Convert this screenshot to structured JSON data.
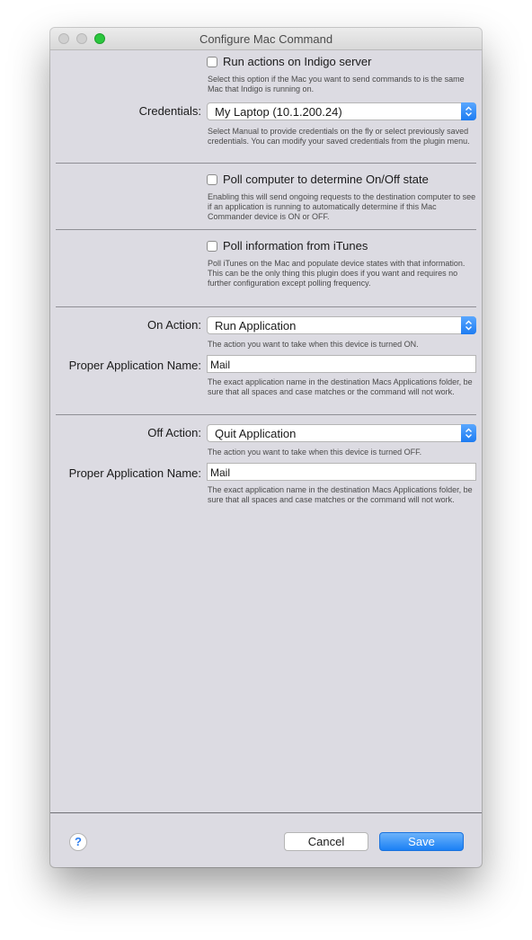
{
  "window": {
    "title": "Configure Mac Command"
  },
  "run_on_server": {
    "label": "Run actions on Indigo server",
    "help": "Select this option if the Mac you want to send commands to is the same Mac that Indigo is running on."
  },
  "credentials": {
    "label": "Credentials:",
    "value": "My Laptop (10.1.200.24)",
    "help": "Select Manual to provide credentials on the fly or select previously saved credentials.  You can modify your saved credentials from the plugin menu."
  },
  "poll_state": {
    "label": "Poll computer to determine On/Off state",
    "help": "Enabling this will send ongoing requests to the destination computer to see if an application is running to automatically determine if this Mac Commander device is ON or OFF."
  },
  "poll_itunes": {
    "label": "Poll information from iTunes",
    "help": "Poll iTunes on the Mac and populate device states with that information.  This can be the only thing this plugin does if you want and requires no further configuration except polling frequency."
  },
  "on_action": {
    "label": "On Action:",
    "value": "Run Application",
    "help": "The action you want to take when this device is turned ON.",
    "app_label": "Proper Application Name:",
    "app_value": "Mail",
    "app_help": "The exact application name in the destination Macs Applications folder, be sure that all spaces and case matches or the command will not work."
  },
  "off_action": {
    "label": "Off Action:",
    "value": "Quit Application",
    "help": "The action you want to take when this device is turned OFF.",
    "app_label": "Proper Application Name:",
    "app_value": "Mail",
    "app_help": "The exact application name in the destination Macs Applications folder, be sure that all spaces and case matches or the command will not work."
  },
  "footer": {
    "help_label": "?",
    "cancel_label": "Cancel",
    "save_label": "Save"
  },
  "colors": {
    "accent": "#1b80f5",
    "dialog_bg": "#dcdbe2"
  },
  "icons": [
    "close-light",
    "minimize-light",
    "zoom-light",
    "popup-chevron-icon",
    "help-icon"
  ]
}
